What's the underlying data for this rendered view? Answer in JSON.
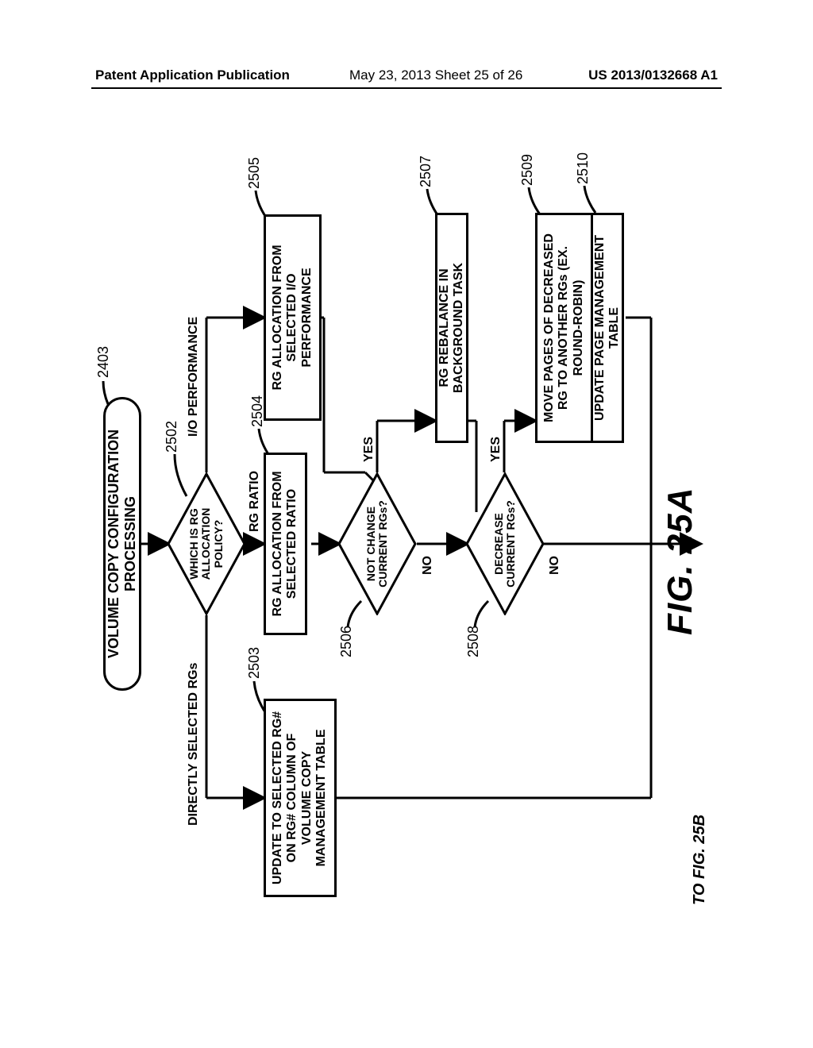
{
  "header": {
    "left": "Patent Application Publication",
    "middle": "May 23, 2013  Sheet 25 of 26",
    "right": "US 2013/0132668 A1"
  },
  "figure": {
    "caption": "FIG. 25A",
    "continued_to": "TO FIG. 25B"
  },
  "fc": {
    "start": "VOLUME COPY CONFIGURATION PROCESSING",
    "d2502": {
      "text": "WHICH IS RG ALLOCATION POLICY?",
      "left": "DIRECTLY SELECTED RGs",
      "mid": "RG RATIO",
      "right": "I/O PERFORMANCE"
    },
    "p2503": "UPDATE TO SELECTED RG# ON RG# COLUMN OF VOLUME COPY MANAGEMENT TABLE",
    "p2504": "RG ALLOCATION FROM SELECTED RATIO",
    "p2505": "RG ALLOCATION FROM SELECTED I/O PERFORMANCE",
    "d2506": {
      "text": "NOT CHANGE CURRENT RGs?",
      "no": "NO",
      "yes": "YES"
    },
    "p2507": "RG REBALANCE IN BACKGROUND TASK",
    "d2508": {
      "text": "DECREASE CURRENT RGs?",
      "no": "NO",
      "yes": "YES"
    },
    "p2509": "MOVE PAGES OF DECREASED RG TO ANOTHER RGs (EX. ROUND-ROBIN)",
    "p2510": "UPDATE PAGE MANAGEMENT TABLE",
    "refs": {
      "r2403": "2403",
      "r2502": "2502",
      "r2503": "2503",
      "r2504": "2504",
      "r2505": "2505",
      "r2506": "2506",
      "r2507": "2507",
      "r2508": "2508",
      "r2509": "2509",
      "r2510": "2510"
    }
  }
}
